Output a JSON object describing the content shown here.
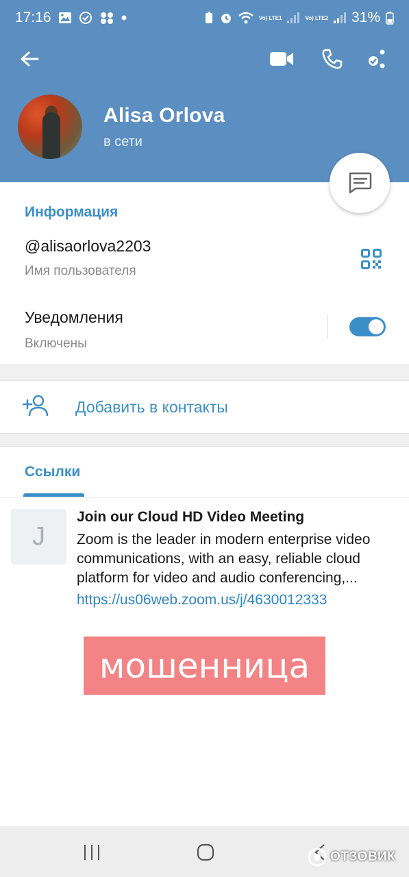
{
  "status_bar": {
    "time": "17:16",
    "battery": "31%",
    "sim1_label": "Vo) LTE1",
    "sim2_label": "Vo) LTE2"
  },
  "header": {
    "name": "Alisa Orlova",
    "status": "в сети"
  },
  "info": {
    "section_title": "Информация",
    "username": "@alisaorlova2203",
    "username_label": "Имя пользователя",
    "notifications": "Уведомления",
    "notifications_state": "Включены",
    "notifications_enabled": true
  },
  "actions": {
    "add_contact": "Добавить в контакты"
  },
  "tabs": {
    "links_label": "Ссылки"
  },
  "link_item": {
    "thumb_letter": "J",
    "title": "Join our Cloud HD Video Meeting",
    "description": "Zoom is the leader in modern enterprise video communications, with an easy, reliable cloud platform for video and audio conferencing,...",
    "url": "https://us06web.zoom.us/j/4630012333"
  },
  "overlay_stamp": {
    "text": "мошенница",
    "color": "#f38384"
  },
  "watermark": {
    "text": "ОТЗОВИК"
  },
  "colors": {
    "header": "#5b8fc2",
    "accent": "#3b8fc9",
    "link": "#2f86c4"
  },
  "icons": [
    "back-arrow-icon",
    "video-call-icon",
    "phone-icon",
    "more-icon",
    "message-icon",
    "qr-code-icon",
    "add-contact-icon",
    "recent-apps-icon",
    "home-icon",
    "back-icon"
  ]
}
